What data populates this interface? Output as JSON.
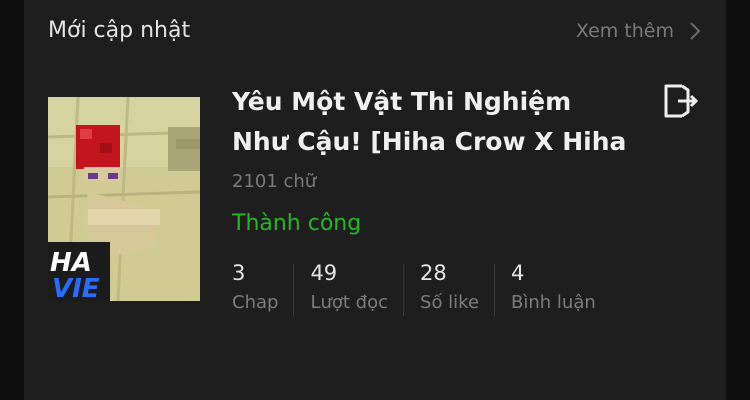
{
  "section": {
    "title": "Mới cập nhật",
    "see_more_label": "Xem thêm"
  },
  "story": {
    "title": "Yêu Một Vật Thi Nghiệm Như Cậu! [Hiha Crow X Hiha The",
    "word_count": "2101 chữ",
    "status": "Thành công",
    "status_color": "#25b825",
    "stats": [
      {
        "value": "3",
        "label": "Chap"
      },
      {
        "value": "49",
        "label": "Lượt đọc"
      },
      {
        "value": "28",
        "label": "Số like"
      },
      {
        "value": "4",
        "label": "Bình luận"
      }
    ]
  },
  "icons": {
    "see_more": "chevron-right-icon",
    "action": "exit-icon"
  }
}
